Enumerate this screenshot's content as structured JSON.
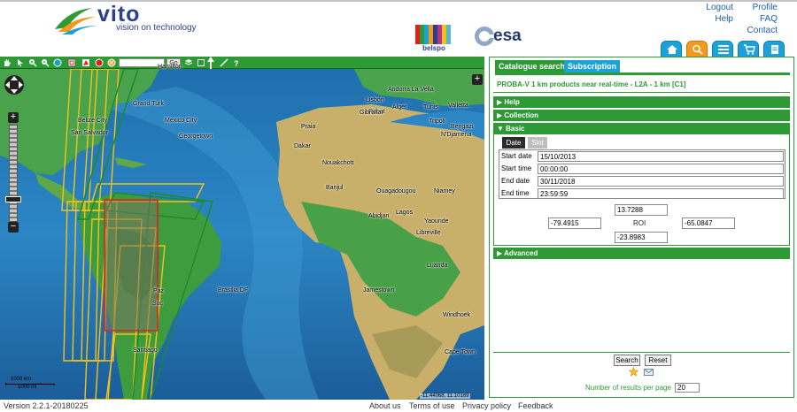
{
  "header": {
    "vito_word": "vito",
    "vito_tagline": "vision on technology",
    "belspo_word": "belspo",
    "esa_word": "esa",
    "links": {
      "logout": "Logout",
      "help": "Help",
      "profile": "Profile",
      "faq": "FAQ",
      "contact": "Contact"
    },
    "nav_buttons": [
      "home-icon",
      "search-icon",
      "list-icon",
      "cart-icon",
      "document-icon"
    ],
    "colors": {
      "brand_blue": "#2a3f8e",
      "nav_blue": "#1da1d9",
      "nav_active": "#f39a1d"
    }
  },
  "map": {
    "search_go": "Go",
    "places": [
      {
        "name": "Ottawa"
      },
      {
        "name": "Hamilton"
      },
      {
        "name": "Grand Turk"
      },
      {
        "name": "Belize City"
      },
      {
        "name": "San Salvador"
      },
      {
        "name": "Mexico City"
      },
      {
        "name": "Georgetown"
      },
      {
        "name": "Nouakchott"
      },
      {
        "name": "Praia"
      },
      {
        "name": "Banjul"
      },
      {
        "name": "Ouagadougou"
      },
      {
        "name": "Niamey"
      },
      {
        "name": "N'Djamena"
      },
      {
        "name": "Abidjan"
      },
      {
        "name": "Lagos"
      },
      {
        "name": "Yaounde"
      },
      {
        "name": "Libreville"
      },
      {
        "name": "Luanda"
      },
      {
        "name": "Brasilia DF"
      },
      {
        "name": "Jamestown"
      },
      {
        "name": "Windhoek"
      },
      {
        "name": "Cape Town"
      },
      {
        "name": "Santiago"
      },
      {
        "name": "Andorra La Vella"
      },
      {
        "name": "Lisbon"
      },
      {
        "name": "Rabat"
      },
      {
        "name": "Alger"
      },
      {
        "name": "Gibraltar"
      },
      {
        "name": "Tunis"
      },
      {
        "name": "Tripoli"
      },
      {
        "name": "Bengazi"
      },
      {
        "name": "Valletta"
      },
      {
        "name": "Dakar"
      },
      {
        "name": "Suc"
      },
      {
        "name": "Paz"
      }
    ],
    "scale_top": "1000 km",
    "scale_bottom": "1000 mi",
    "coords": "-11.44068, 11.10169",
    "colors": {
      "ocean": "#1e5fa0",
      "land": "#3fa24a",
      "footprint_yellow": "#f2c21a",
      "footprint_green": "#1c8a2a",
      "roi_red": "#e0201f"
    }
  },
  "panel": {
    "tabs": [
      {
        "label": "Catalogue search",
        "active": true
      },
      {
        "label": "Subscription",
        "active": false
      }
    ],
    "product_title": "PROBA-V 1 km products near real-time - L2A - 1 km [C1]",
    "sections": {
      "help": "Help",
      "collection": "Collection",
      "basic": "Basic",
      "advanced": "Advanced"
    },
    "mode_buttons": {
      "date": "Date",
      "slot": "Slot"
    },
    "dates": [
      {
        "label": "Start date",
        "value": "15/10/2013"
      },
      {
        "label": "Start time",
        "value": "00:00:00"
      },
      {
        "label": "End date",
        "value": "30/11/2018"
      },
      {
        "label": "End time",
        "value": "23:59:59"
      }
    ],
    "roi": {
      "label": "ROI",
      "north": "13.7288",
      "west": "-79.4915",
      "east": "-65.0847",
      "south": "-23.8983"
    },
    "buttons": {
      "search": "Search",
      "reset": "Reset"
    },
    "results_label": "Number of results per page",
    "results_value": "20",
    "colors": {
      "accent_green": "#2d9a35"
    }
  },
  "footer": {
    "version": "Version 2.2.1-20180225",
    "links": {
      "about": "About us",
      "terms": "Terms of use",
      "privacy": "Privacy policy",
      "feedback": "Feedback"
    }
  }
}
